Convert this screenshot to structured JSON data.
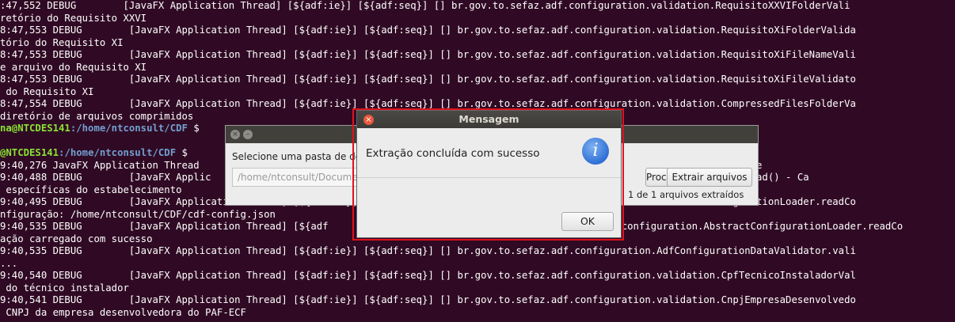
{
  "terminal": {
    "lines": [
      {
        "type": "text",
        "text": ":47,552 DEBUG        [JavaFX Application Thread] [${adf:ie}] [${adf:seq}] [] br.gov.to.sefaz.adf.configuration.validation.RequisitoXXVIFolderVali"
      },
      {
        "type": "text",
        "text": "retório do Requisito XXVI"
      },
      {
        "type": "text",
        "text": "8:47,553 DEBUG        [JavaFX Application Thread] [${adf:ie}] [${adf:seq}] [] br.gov.to.sefaz.adf.configuration.validation.RequisitoXiFolderValida"
      },
      {
        "type": "text",
        "text": "tório do Requisito XI"
      },
      {
        "type": "text",
        "text": "8:47,553 DEBUG        [JavaFX Application Thread] [${adf:ie}] [${adf:seq}] [] br.gov.to.sefaz.adf.configuration.validation.RequisitoXiFileNameVali"
      },
      {
        "type": "text",
        "text": "e arquivo do Requisito XI"
      },
      {
        "type": "text",
        "text": "8:47,553 DEBUG        [JavaFX Application Thread] [${adf:ie}] [${adf:seq}] [] br.gov.to.sefaz.adf.configuration.validation.RequisitoXiFileValidato"
      },
      {
        "type": "text",
        "text": " do Requisito XI"
      },
      {
        "type": "text",
        "text": "8:47,554 DEBUG        [JavaFX Application Thread] [${adf:ie}] [${adf:seq}] [] br.gov.to.sefaz.adf.configuration.validation.CompressedFilesFolderVa"
      },
      {
        "type": "text",
        "text": "diretório de arquivos comprimidos"
      },
      {
        "type": "prompt",
        "user": "na@NTCDES141",
        "path": ":/home/ntconsult/CDF",
        "rest": " $"
      },
      {
        "type": "text",
        "text": ""
      },
      {
        "type": "prompt",
        "user": "@NTCDES141",
        "path": ":/home/ntconsult/CDF",
        "rest": " $"
      },
      {
        "type": "text",
        "text": "9:40,276 JavaFX Application Thread                                                                          bufferedIO is not true"
      },
      {
        "type": "text",
        "text": "9:40,488 DEBUG        [JavaFX Applic                                                                        onfigurationLoader.load() - Ca"
      },
      {
        "type": "text",
        "text": " específicas do estabelecimento"
      },
      {
        "type": "text",
        "text": "9:40,495 DEBUG        [JavaFX Application Thread] [${adf:ie}] [${adf:seq}] [] br.gov.to.sefaz.adf.configuration.AbstractConfigurationLoader.readCo"
      },
      {
        "type": "text",
        "text": "nfiguração: /home/ntconsult/CDF/cdf-config.json"
      },
      {
        "type": "text",
        "text": "9:40,535 DEBUG        [JavaFX Application Thread] [${adf                                                 .configuration.AbstractConfigurationLoader.readCo"
      },
      {
        "type": "text",
        "text": "ação carregado com sucesso"
      },
      {
        "type": "text",
        "text": "9:40,535 DEBUG        [JavaFX Application Thread] [${adf:ie}] [${adf:seq}] [] br.gov.to.sefaz.adf.configuration.AdfConfigurationDataValidator.vali"
      },
      {
        "type": "text",
        "text": "..."
      },
      {
        "type": "text",
        "text": "9:40,540 DEBUG        [JavaFX Application Thread] [${adf:ie}] [${adf:seq}] [] br.gov.to.sefaz.adf.configuration.validation.CpfTecnicoInstaladorVal"
      },
      {
        "type": "text",
        "text": " do técnico instalador"
      },
      {
        "type": "text",
        "text": "9:40,541 DEBUG        [JavaFX Application Thread] [${adf:ie}] [${adf:seq}] [] br.gov.to.sefaz.adf.configuration.validation.CnpjEmpresaDesenvolvedo"
      },
      {
        "type": "text",
        "text": " CNPJ da empresa desenvolvedora do PAF-ECF"
      }
    ]
  },
  "app_window": {
    "label": "Selecione uma pasta de destino:",
    "path_value": "/home/ntconsult/Documentos",
    "browse_label": "Procurar",
    "extract_label": "Extrair arquivos",
    "status": "1 de 1 arquivos extraídos"
  },
  "dialog": {
    "title": "Mensagem",
    "message": "Extração concluída com sucesso",
    "icon": "info-icon",
    "ok_label": "OK"
  },
  "colors": {
    "terminal_bg": "#300a24",
    "prompt_user": "#8ae234",
    "prompt_path": "#729fcf",
    "highlight": "#e0121c"
  }
}
